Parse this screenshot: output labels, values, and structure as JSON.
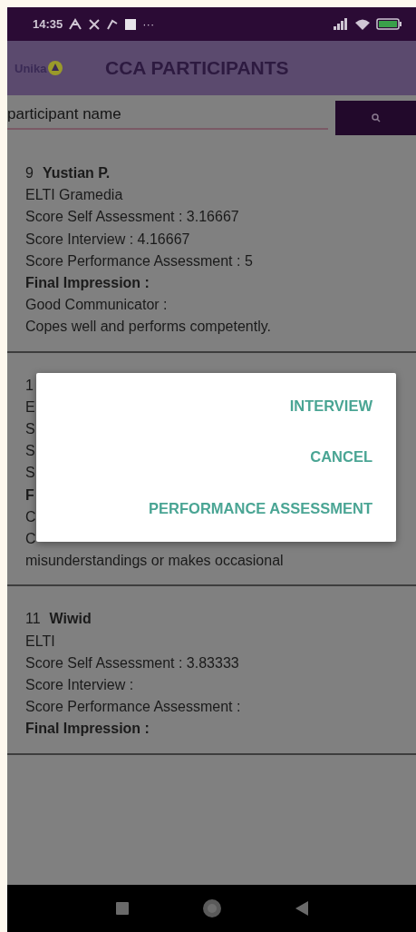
{
  "status_bar": {
    "time": "14:35",
    "more": "···"
  },
  "app_bar": {
    "logo_text": "Unika",
    "title": "CCA PARTICIPANTS"
  },
  "search": {
    "placeholder": "participant name"
  },
  "cards": [
    {
      "lines": [
        {
          "kind": "header",
          "number": "9",
          "name": "Yustian P."
        },
        {
          "kind": "plain",
          "text": "ELTI Gramedia"
        },
        {
          "kind": "plain",
          "text": "Score Self Assessment :  3.16667"
        },
        {
          "kind": "plain",
          "text": "Score Interview :  4.16667"
        },
        {
          "kind": "plain",
          "text": "Score Performance Assessment :  5"
        },
        {
          "kind": "bold",
          "text": "Final Impression :"
        },
        {
          "kind": "plain",
          "text": "Good Communicator :"
        },
        {
          "kind": "plain",
          "text": "Copes well and performs competently."
        }
      ]
    },
    {
      "lines": [
        {
          "kind": "plain",
          "text": "1"
        },
        {
          "kind": "plain",
          "text": "E"
        },
        {
          "kind": "plain",
          "text": "S"
        },
        {
          "kind": "plain",
          "text": "S"
        },
        {
          "kind": "plain",
          "text": "S"
        },
        {
          "kind": "bold",
          "text": "F"
        },
        {
          "kind": "plain",
          "text": "C"
        },
        {
          "kind": "plain",
          "text": "C"
        },
        {
          "kind": "plain",
          "text": "misunderstandings or makes occasional"
        }
      ]
    },
    {
      "lines": [
        {
          "kind": "header",
          "number": "11",
          "name": "Wiwid"
        },
        {
          "kind": "plain",
          "text": "ELTI"
        },
        {
          "kind": "plain",
          "text": "Score Self Assessment :  3.83333"
        },
        {
          "kind": "plain",
          "text": "Score Interview :"
        },
        {
          "kind": "plain",
          "text": "Score Performance Assessment :"
        },
        {
          "kind": "bold",
          "text": "Final Impression :"
        }
      ]
    }
  ],
  "dialog": {
    "options": [
      "INTERVIEW",
      "CANCEL",
      "PERFORMANCE ASSESSMENT"
    ]
  }
}
